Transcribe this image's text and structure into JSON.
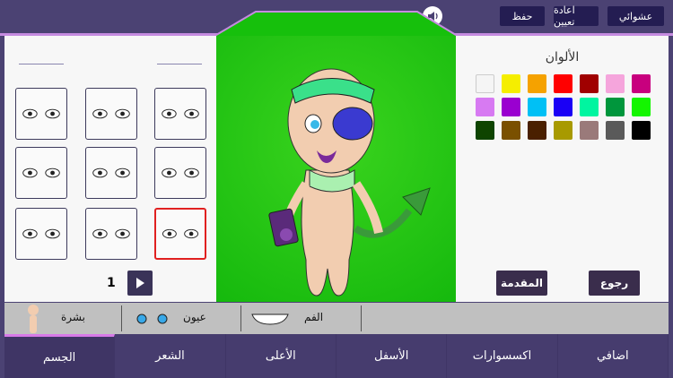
{
  "toolbar": {
    "random": "عشوائي",
    "reset": "اعادة تعيين",
    "save": "حفظ",
    "sound_icon": "speaker-icon"
  },
  "left_panel": {
    "page": "1",
    "play_icon": "play-icon"
  },
  "colors_panel": {
    "title": "الألوان",
    "swatches": [
      "#f5f5f5",
      "#f5ee00",
      "#f5a200",
      "#ff0000",
      "#a00000",
      "#f5a5dc",
      "#c8007e",
      "#d77af2",
      "#9a00d0",
      "#00c0f5",
      "#1a00f5",
      "#00f5a0",
      "#00963c",
      "#14f500",
      "#0e4400",
      "#7a5000",
      "#4a2000",
      "#a89a00",
      "#9a7a7a",
      "#5a5a5a",
      "#000000"
    ],
    "back": "رجوع",
    "intro": "المقدمة"
  },
  "parts": {
    "skin": "بشرة",
    "eyes": "عيون",
    "mouth": "الفم"
  },
  "tabs": [
    "الجسم",
    "الشعر",
    "الأعلى",
    "الأسفل",
    "اكسسوارات",
    "اضافي"
  ]
}
